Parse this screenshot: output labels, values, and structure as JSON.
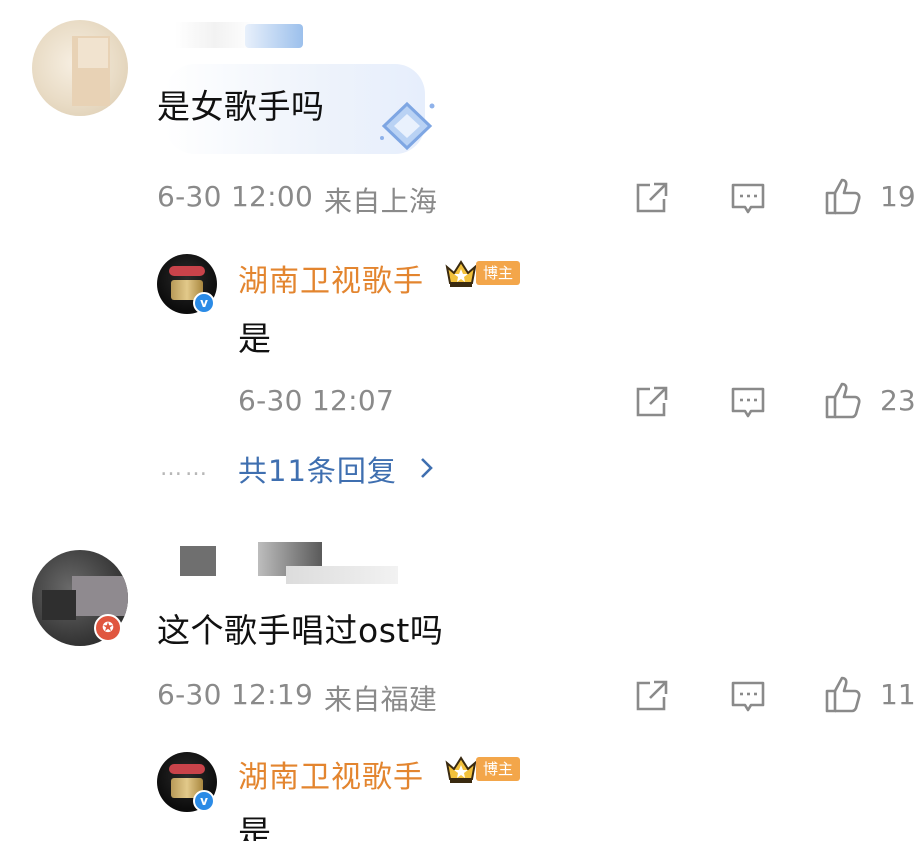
{
  "comments": [
    {
      "text": "是女歌手吗",
      "time": "6-30 12:00",
      "location": "来自上海",
      "likes": "19",
      "reply": {
        "user": "湖南卫视歌手",
        "badge": "博主",
        "text": "是",
        "time": "6-30 12:07",
        "likes": "23"
      },
      "more_replies": "共11条回复",
      "more_dots": "……"
    },
    {
      "text": "这个歌手唱过ost吗",
      "time": "6-30 12:19",
      "location": "来自福建",
      "likes": "11",
      "reply": {
        "user": "湖南卫视歌手",
        "badge": "博主",
        "text": "是"
      }
    }
  ],
  "colors": {
    "username": "#e3852f",
    "link": "#3f6fb0",
    "meta": "#8a8a8a",
    "badge": "#f3a64a",
    "verified": "#2b8be6"
  },
  "icons": [
    "share-icon",
    "comment-icon",
    "like-icon",
    "chevron-right-icon",
    "crown-icon",
    "verified-icon",
    "diamond-sticker-icon"
  ]
}
